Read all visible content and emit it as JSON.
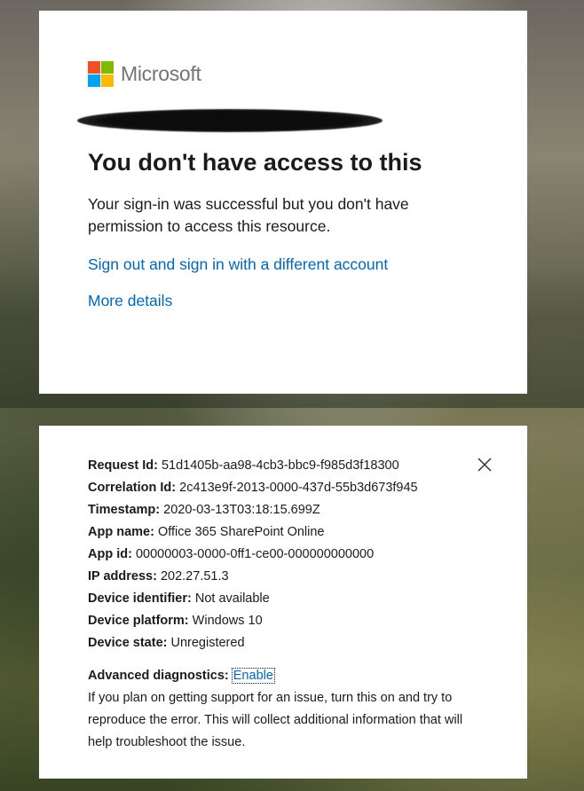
{
  "colors": {
    "link": "#0067b8",
    "text": "#1b1b1b",
    "brand_text": "#737373",
    "logo": [
      "#f25022",
      "#7fba00",
      "#00a4ef",
      "#ffb900"
    ]
  },
  "brand": {
    "name": "Microsoft"
  },
  "main": {
    "title": "You don't have access to this",
    "description": "Your sign-in was successful but you don't have permission to access this resource.",
    "signout_link": "Sign out and sign in with a different account",
    "more_details_link": "More details"
  },
  "details": {
    "close_icon": "close-icon",
    "rows": [
      {
        "key": "Request Id:",
        "value": "51d1405b-aa98-4cb3-bbc9-f985d3f18300"
      },
      {
        "key": "Correlation Id:",
        "value": "2c413e9f-2013-0000-437d-55b3d673f945"
      },
      {
        "key": "Timestamp:",
        "value": "2020-03-13T03:18:15.699Z"
      },
      {
        "key": "App name:",
        "value": "Office 365 SharePoint Online"
      },
      {
        "key": "App id:",
        "value": "00000003-0000-0ff1-ce00-000000000000"
      },
      {
        "key": "IP address:",
        "value": "202.27.51.3"
      },
      {
        "key": "Device identifier:",
        "value": "Not available"
      },
      {
        "key": "Device platform:",
        "value": "Windows 10"
      },
      {
        "key": "Device state:",
        "value": "Unregistered"
      }
    ],
    "advanced_label": "Advanced diagnostics:",
    "enable_link": "Enable",
    "advanced_description": "If you plan on getting support for an issue, turn this on and try to reproduce the error. This will collect additional information that will help troubleshoot the issue."
  }
}
